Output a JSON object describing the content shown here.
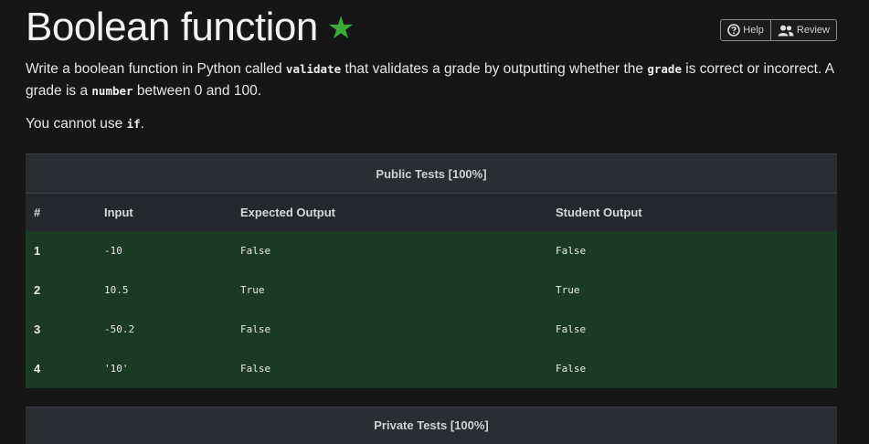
{
  "header": {
    "title": "Boolean function",
    "star": "★",
    "help_label": "Help",
    "review_label": "Review"
  },
  "description": {
    "line1_a": "Write a boolean function in Python called ",
    "code_validate": "validate",
    "line1_b": " that validates a grade by outputting whether the ",
    "code_grade": "grade",
    "line1_c": " is correct or incorrect. A grade is a ",
    "code_number": "number",
    "line1_d": " between 0 and 100.",
    "line2_a": "You cannot use ",
    "code_if": "if",
    "line2_b": "."
  },
  "public_tests": {
    "caption": "Public Tests [100%]",
    "columns": [
      "#",
      "Input",
      "Expected Output",
      "Student Output"
    ],
    "rows": [
      {
        "num": "1",
        "input": "-10",
        "expected": "False",
        "student": "False"
      },
      {
        "num": "2",
        "input": "10.5",
        "expected": "True",
        "student": "True"
      },
      {
        "num": "3",
        "input": "-50.2",
        "expected": "False",
        "student": "False"
      },
      {
        "num": "4",
        "input": "'10'",
        "expected": "False",
        "student": "False"
      }
    ],
    "pass_color": "#1b3a23"
  },
  "private_tests": {
    "caption": "Private Tests [100%]"
  },
  "colors": {
    "star": "#3aa83a",
    "background": "#161616"
  }
}
